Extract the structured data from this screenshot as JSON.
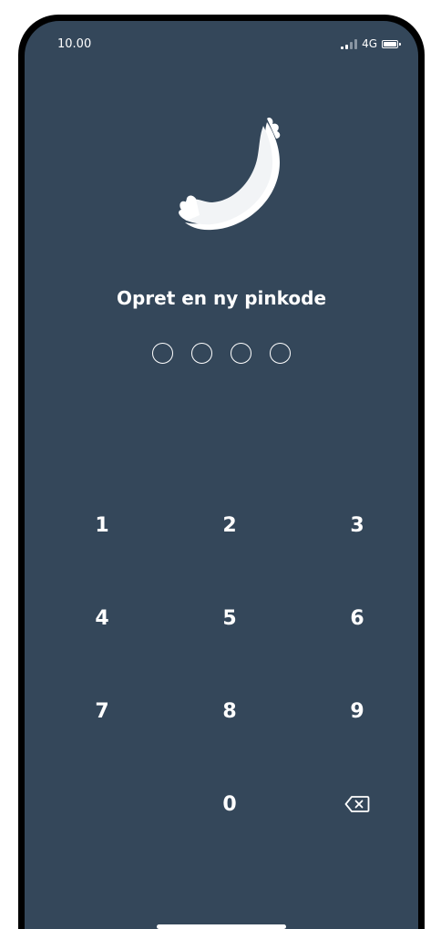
{
  "status_bar": {
    "time": "10.00",
    "network": "4G"
  },
  "pin_screen": {
    "title": "Opret en ny pinkode",
    "pin_length": 4,
    "entered_digits": 0
  },
  "keypad": {
    "keys": [
      "1",
      "2",
      "3",
      "4",
      "5",
      "6",
      "7",
      "8",
      "9",
      "0"
    ],
    "backspace_icon": "backspace-icon"
  },
  "colors": {
    "background": "#34475a",
    "foreground": "#ffffff"
  }
}
